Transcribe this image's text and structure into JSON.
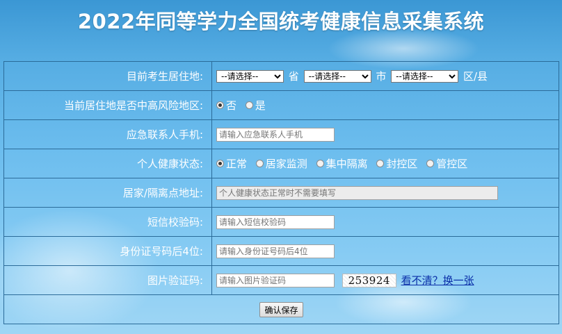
{
  "title": "2022年同等学力全国统考健康信息采集系统",
  "form": {
    "residence": {
      "label": "目前考生居住地:",
      "province_select": "--请选择--",
      "province_unit": "省",
      "city_select": "--请选择--",
      "city_unit": "市",
      "county_select": "--请选择--",
      "county_unit": "区/县"
    },
    "risk_area": {
      "label": "当前居住地是否中高风险地区:",
      "options": [
        "否",
        "是"
      ],
      "selected": "否"
    },
    "emergency_phone": {
      "label": "应急联系人手机:",
      "placeholder": "请输入应急联系人手机"
    },
    "health_status": {
      "label": "个人健康状态:",
      "options": [
        "正常",
        "居家监测",
        "集中隔离",
        "封控区",
        "管控区"
      ],
      "selected": "正常"
    },
    "isolation_address": {
      "label": "居家/隔离点地址:",
      "placeholder": "个人健康状态正常时不需要填写"
    },
    "sms_code": {
      "label": "短信校验码:",
      "placeholder": "请输入短信校验码"
    },
    "id_last4": {
      "label": "身份证号码后4位:",
      "placeholder": "请输入身份证号码后4位"
    },
    "image_code": {
      "label": "图片验证码:",
      "placeholder": "请输入图片验证码",
      "captcha_text": "253924",
      "refresh_link": "看不清？换一张"
    },
    "submit_label": "确认保存"
  },
  "colors": {
    "background_top": "#3b97d4",
    "background_bottom": "#9fd6f5",
    "border": "#2b6b99",
    "link": "#0a2ea8"
  }
}
